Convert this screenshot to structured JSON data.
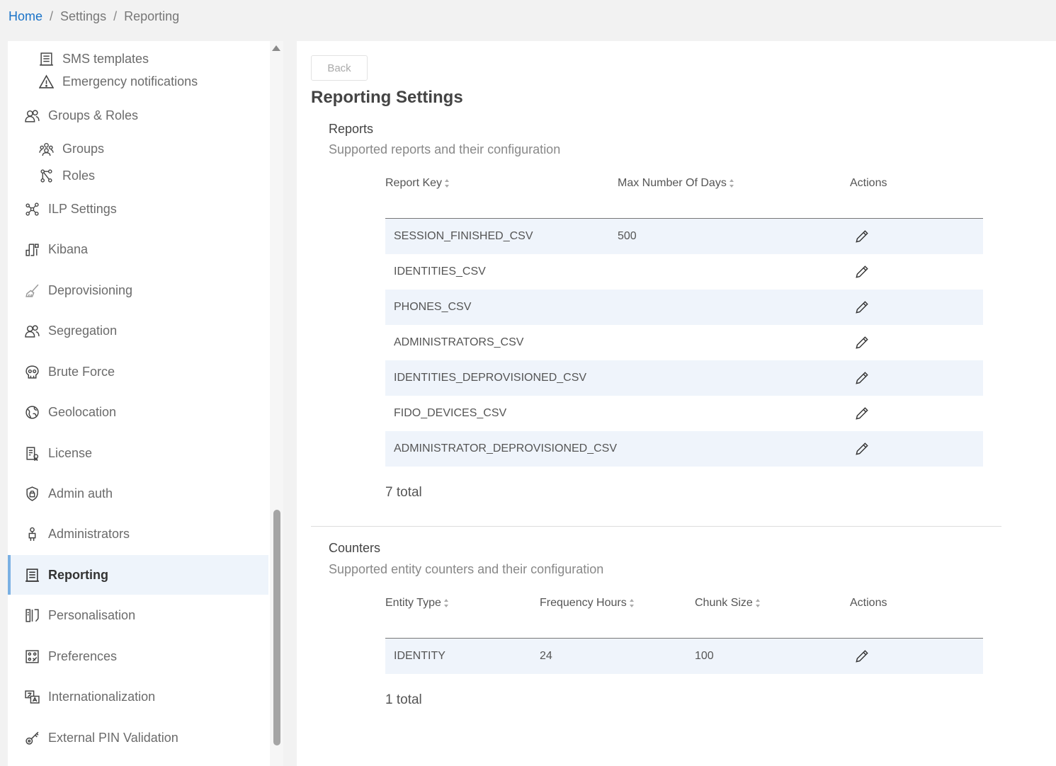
{
  "breadcrumb": {
    "home": "Home",
    "settings": "Settings",
    "current": "Reporting",
    "separator": "/"
  },
  "sidebar": {
    "sub_top": [
      {
        "label": "SMS templates",
        "icon": "list-icon"
      },
      {
        "label": "Emergency notifications",
        "icon": "warning-icon"
      }
    ],
    "groups_roles": {
      "label": "Groups & Roles",
      "icon": "users-icon"
    },
    "sub_groups": [
      {
        "label": "Groups",
        "icon": "group-icon"
      },
      {
        "label": "Roles",
        "icon": "hierarchy-icon"
      }
    ],
    "items": [
      {
        "label": "ILP Settings",
        "icon": "network-icon"
      },
      {
        "label": "Kibana",
        "icon": "kibana-icon"
      },
      {
        "label": "Deprovisioning",
        "icon": "broom-icon"
      },
      {
        "label": "Segregation",
        "icon": "users-icon"
      },
      {
        "label": "Brute Force",
        "icon": "skull-icon"
      },
      {
        "label": "Geolocation",
        "icon": "globe-icon"
      },
      {
        "label": "License",
        "icon": "license-icon"
      },
      {
        "label": "Admin auth",
        "icon": "shield-lock-icon"
      },
      {
        "label": "Administrators",
        "icon": "admin-icon"
      },
      {
        "label": "Reporting",
        "icon": "report-icon"
      },
      {
        "label": "Personalisation",
        "icon": "columns-icon"
      },
      {
        "label": "Preferences",
        "icon": "preferences-icon"
      },
      {
        "label": "Internationalization",
        "icon": "translate-icon"
      },
      {
        "label": "External PIN Validation",
        "icon": "key-icon"
      }
    ],
    "active": "Reporting"
  },
  "main": {
    "back_label": "Back",
    "title": "Reporting Settings",
    "reports": {
      "title": "Reports",
      "description": "Supported reports and their configuration",
      "columns": [
        "Report Key",
        "Max Number Of Days",
        "Actions"
      ],
      "rows": [
        {
          "key": "SESSION_FINISHED_CSV",
          "max_days": "500"
        },
        {
          "key": "IDENTITIES_CSV",
          "max_days": ""
        },
        {
          "key": "PHONES_CSV",
          "max_days": ""
        },
        {
          "key": "ADMINISTRATORS_CSV",
          "max_days": ""
        },
        {
          "key": "IDENTITIES_DEPROVISIONED_CSV",
          "max_days": ""
        },
        {
          "key": "FIDO_DEVICES_CSV",
          "max_days": ""
        },
        {
          "key": "ADMINISTRATOR_DEPROVISIONED_CSV",
          "max_days": ""
        }
      ],
      "total": "7 total"
    },
    "counters": {
      "title": "Counters",
      "description": "Supported entity counters and their configuration",
      "columns": [
        "Entity Type",
        "Frequency Hours",
        "Chunk Size",
        "Actions"
      ],
      "rows": [
        {
          "entity_type": "IDENTITY",
          "frequency_hours": "24",
          "chunk_size": "100"
        }
      ],
      "total": "1 total"
    }
  },
  "colors": {
    "link": "#1a73c8",
    "active_bg": "#eef4fb",
    "active_border": "#7ab0e3",
    "stripe": "#eff4fb"
  }
}
